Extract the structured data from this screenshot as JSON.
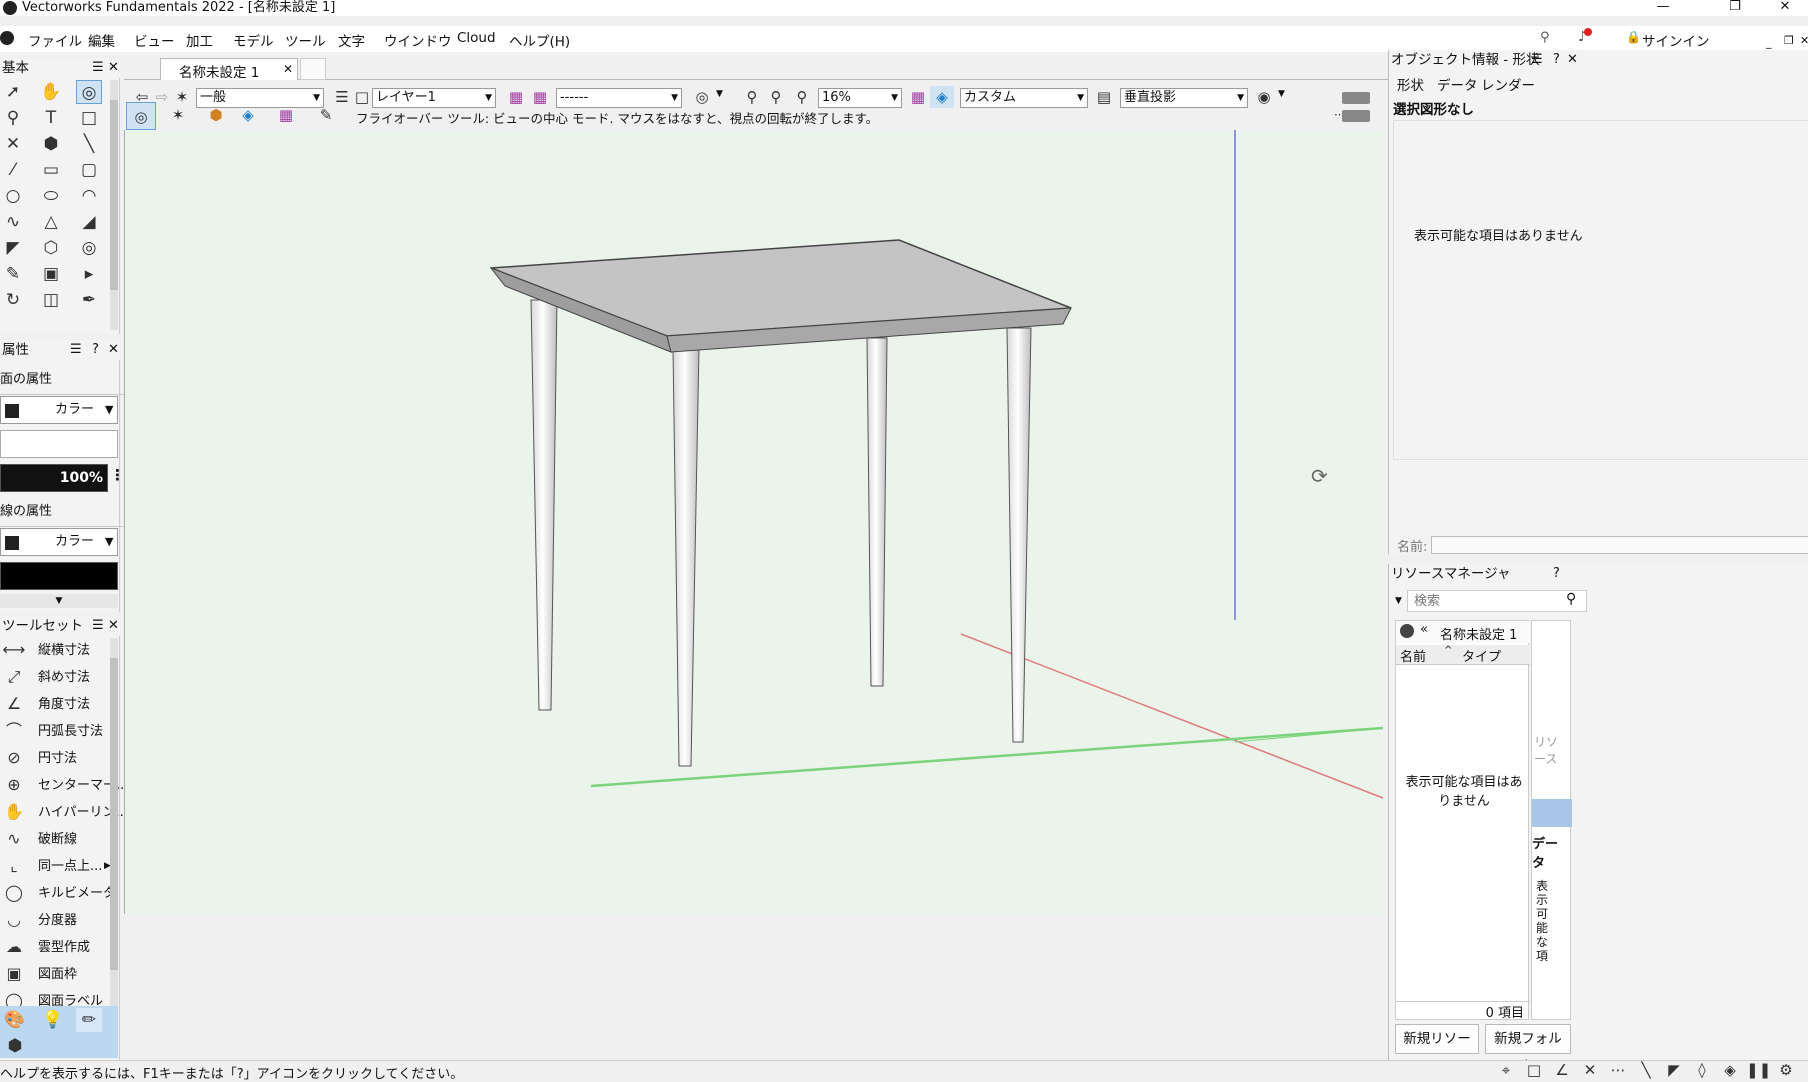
{
  "app": {
    "title": "Vectorworks Fundamentals 2022 - [名称未設定 1]",
    "logo": "vectorworks-logo-icon"
  },
  "window_controls": {
    "minimize": "—",
    "restore": "❐",
    "close": "✕"
  },
  "menu": {
    "items": [
      "ファイル",
      "編集",
      "ビュー",
      "加工",
      "モデル",
      "ツール",
      "文字",
      "ウインドウ",
      "Cloud",
      "ヘルプ(H)"
    ],
    "signin": "サインイン",
    "notification_badge_color": "#e02020"
  },
  "basic_palette": {
    "title": "基本",
    "tools": [
      "cursor-icon",
      "hand-pan-icon",
      "flyover-icon",
      "zoom-icon",
      "text-icon",
      "callout-icon",
      "trim-icon",
      "3d-box-icon",
      "line-icon",
      "double-line-icon",
      "rectangle-icon",
      "rounded-rect-icon",
      "circle-icon",
      "oval-icon",
      "arc-icon",
      "freehand-icon",
      "polyline-icon",
      "polygon-icon",
      "double-polygon-icon",
      "regular-polygon-icon",
      "spiral-icon",
      "eyedropper-icon",
      "resize-icon",
      "reshape-icon",
      "rotate-icon",
      "mirror-icon",
      "pen-icon"
    ]
  },
  "attributes": {
    "title": "属性",
    "fill_label": "面の属性",
    "fill_type": "カラー",
    "opacity": "100%",
    "line_label": "線の属性",
    "line_type": "カラー",
    "line_color": "#000000"
  },
  "toolset": {
    "title": "ツールセット",
    "items": [
      {
        "icon": "dimension-constrained-icon",
        "label": "縦横寸法"
      },
      {
        "icon": "dimension-unconstrained-icon",
        "label": "斜め寸法"
      },
      {
        "icon": "angle-dimension-icon",
        "label": "角度寸法"
      },
      {
        "icon": "arc-length-dimension-icon",
        "label": "円弧長寸法"
      },
      {
        "icon": "radial-dimension-icon",
        "label": "円寸法"
      },
      {
        "icon": "center-mark-icon",
        "label": "センターマー..."
      },
      {
        "icon": "hyperlink-icon",
        "label": "ハイパーリン..."
      },
      {
        "icon": "break-line-icon",
        "label": "破断線"
      },
      {
        "icon": "coordinate-dim-icon",
        "label": "同一点上..."
      },
      {
        "icon": "tape-measure-icon",
        "label": "キルビメータ"
      },
      {
        "icon": "protractor-icon",
        "label": "分度器"
      },
      {
        "icon": "cloud-icon",
        "label": "雲型作成"
      },
      {
        "icon": "drawing-border-icon",
        "label": "図面枠"
      },
      {
        "icon": "drawing-label-icon",
        "label": "図面ラベル"
      }
    ],
    "bottom_tabs": [
      "color-palette-icon",
      "lightbulb-icon",
      "pencil-ruler-icon",
      "extrude-icon"
    ]
  },
  "document_tab": {
    "label": "名称未設定 1",
    "close": "✕"
  },
  "view_bar": {
    "class": "一般",
    "layer": "レイヤー1",
    "saved_view": "------",
    "zoom": "16%",
    "render_mode": "カスタム",
    "projection": "垂直投影"
  },
  "mode_bar": {
    "hint": "フライオーバー ツール: ビューの中心 モード. マウスをはなすと、視点の回転が終了します。"
  },
  "object_info": {
    "title": "オブジェクト情報 - 形状",
    "tabs": [
      "形状",
      "データ",
      "レンダー"
    ],
    "selection": "選択図形なし",
    "empty": "表示可能な項目はありません",
    "name_label": "名前:"
  },
  "resource_manager": {
    "title": "リソースマネージャ",
    "search_placeholder": "検索",
    "file_label": "名称未設定 1",
    "columns": [
      "名前",
      "タイプ"
    ],
    "empty": "表示可能な項目はありません",
    "count": "0 項目",
    "new_resource": "新規リソース...",
    "new_folder": "新規フォルダ...",
    "side_label": "リソース",
    "data_label": "データ",
    "vertical_text": "表示可能な項"
  },
  "status_bar": {
    "help": "ヘルプを表示するには、F1キーまたは「?」アイコンをクリックしてください。"
  }
}
